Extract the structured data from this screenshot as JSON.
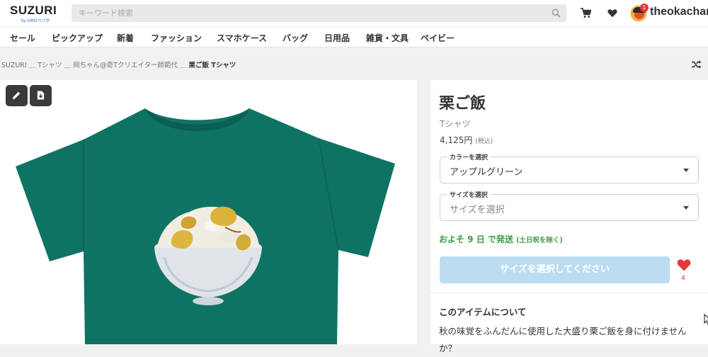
{
  "header": {
    "logo": "SUZURI",
    "logo_sub": "by GMOペパボ",
    "search_placeholder": "キーワード検索",
    "username": "theokachan",
    "notification_count": "1",
    "icons": [
      "search-icon",
      "cart-icon",
      "heart-icon",
      "avatar"
    ]
  },
  "nav": {
    "items": [
      "セール",
      "ピックアップ",
      "新着",
      "ファッション",
      "スマホケース",
      "バッグ",
      "日用品",
      "雑貨・文具",
      "ベイビー"
    ]
  },
  "breadcrumb": {
    "path": "SUZURI ＿ Tシャツ ＿ 岡ちゃん@奇Tクリエイター師範代 ＿ ",
    "current": "栗ご飯 Tシャツ"
  },
  "product": {
    "title": "栗ご飯",
    "type": "Tシャツ",
    "price": "4,125円",
    "tax": "(税込)",
    "color_label": "カラーを選択",
    "color_value": "アップルグリーン",
    "size_label": "サイズを選択",
    "size_placeholder": "サイズを選択",
    "shipping": "およそ 9 日 で発送",
    "shipping_note": "(土日祝を除く)",
    "cta_label": "サイズを選択してください",
    "favorite_count": "4",
    "about_title": "このアイテムについて",
    "about_text": "秋の味覚をふんだんに使用した大盛り栗ご飯を身に付けませんか？"
  },
  "colors": {
    "tshirt": "#0f7363",
    "shipping_green": "#3d9a45",
    "cta_disabled": "#bcdcf2",
    "favorite_red": "#e53935"
  }
}
